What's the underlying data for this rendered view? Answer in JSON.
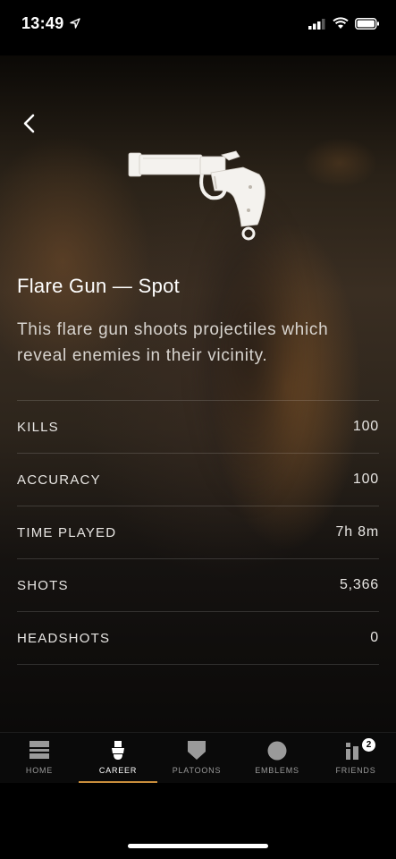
{
  "status_bar": {
    "time": "13:49"
  },
  "weapon": {
    "name": "Flare Gun — Spot",
    "description": "This flare gun shoots projectiles which reveal enemies in their vicinity."
  },
  "stats": [
    {
      "label": "KILLS",
      "value": "100"
    },
    {
      "label": "ACCURACY",
      "value": "100"
    },
    {
      "label": "TIME PLAYED",
      "value": "7h 8m"
    },
    {
      "label": "SHOTS",
      "value": "5,366"
    },
    {
      "label": "HEADSHOTS",
      "value": "0"
    }
  ],
  "tabs": [
    {
      "label": "HOME",
      "icon": "home-icon"
    },
    {
      "label": "CAREER",
      "icon": "soldier-icon",
      "active": true
    },
    {
      "label": "PLATOONS",
      "icon": "shield-icon"
    },
    {
      "label": "EMBLEMS",
      "icon": "circle-emblem-icon"
    },
    {
      "label": "FRIENDS",
      "icon": "friends-icon",
      "badge": "2"
    }
  ],
  "colors": {
    "accent": "#c98e3c",
    "background": "#000000"
  }
}
